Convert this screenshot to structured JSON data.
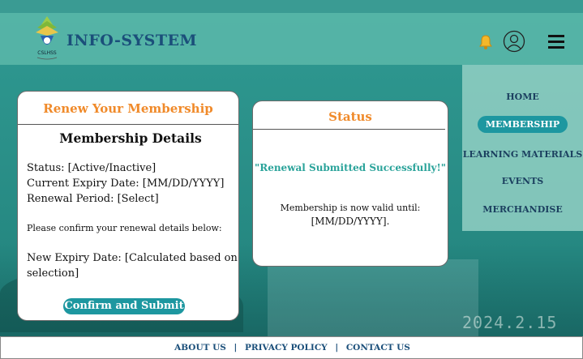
{
  "header": {
    "brand": "INFO-SYSTEM",
    "logo_text": "CSLHSS"
  },
  "nav": {
    "items": [
      {
        "label": "HOME",
        "active": false
      },
      {
        "label": "MEMBERSHIP",
        "active": true
      },
      {
        "label": "LEARNING MATERIALS",
        "active": false
      },
      {
        "label": "EVENTS",
        "active": false
      },
      {
        "label": "MERCHANDISE",
        "active": false
      }
    ]
  },
  "renew_card": {
    "title": "Renew Your Membership",
    "subtitle": "Membership Details",
    "status_line": "Status: [Active/Inactive]",
    "expiry_line": "Current Expiry Date: [MM/DD/YYYY]",
    "period_line": "Renewal Period: [Select]",
    "confirm_prompt": "Please confirm your renewal details below:",
    "new_expiry_line1": "New Expiry Date: [Calculated based on",
    "new_expiry_line2": "selection]",
    "submit_button": "Confirm and Submit"
  },
  "status_card": {
    "title": "Status",
    "message": "\"Renewal Submitted Successfully!\"",
    "valid_line1": "Membership is now valid until:",
    "valid_line2": "[MM/DD/YYYY]."
  },
  "background": {
    "stamp_text": "2024.2.15"
  },
  "footer": {
    "about": "ABOUT US",
    "privacy": "PRIVACY POLICY",
    "contact": "CONTACT US",
    "separator": "|"
  },
  "colors": {
    "accent_teal": "#1d97a0",
    "title_orange": "#f08a2a",
    "brand_blue": "#1b4f7a",
    "success_teal": "#2aa39a"
  }
}
